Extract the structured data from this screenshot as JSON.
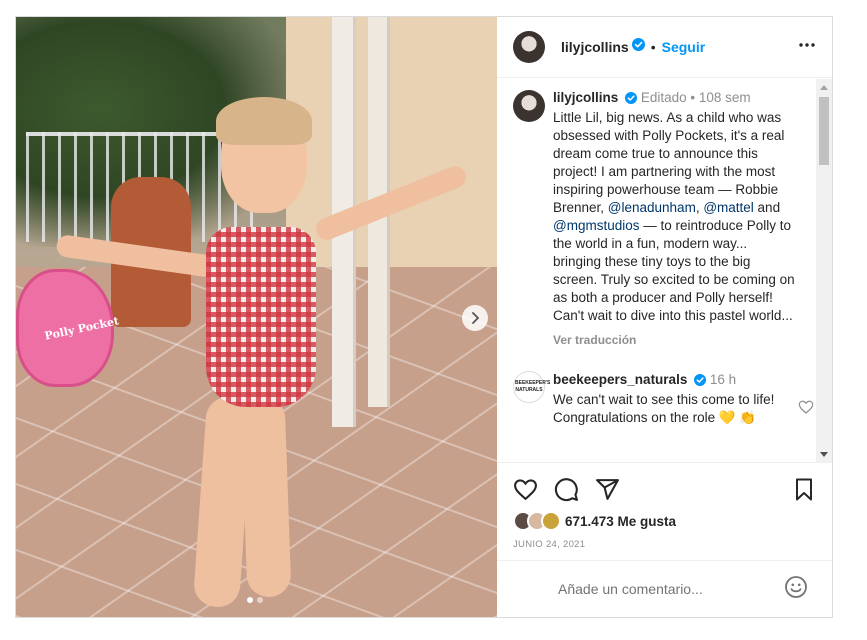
{
  "header": {
    "username": "lilyjcollins",
    "separator": "•",
    "follow_label": "Seguir",
    "more_label": "more"
  },
  "caption": {
    "username": "lilyjcollins",
    "meta": "Editado • 108 sem",
    "text_1": "Little Lil, big news. As a child who was obsessed with Polly Pockets, it's a real dream come true to announce this project! I am partnering with the most inspiring powerhouse team — Robbie Brenner, ",
    "mention_1": "@lenadunham",
    "text_2": ", ",
    "mention_2": "@mattel",
    "text_3": " and ",
    "mention_3": "@mgmstudios",
    "text_4": " — to reintroduce Polly to the world in a fun, modern way... bringing these tiny toys to the big screen. Truly so excited to be coming on as both a producer and Polly herself! Can't wait to dive into this pastel world...",
    "translate_label": "Ver traducción"
  },
  "comment": {
    "username": "beekeepers_naturals",
    "time": "16 h",
    "text": "We can't wait to see this come to life! Congratulations on the role 💛 👏",
    "avatar_text": "BEEKEEPER'S NATURALS"
  },
  "media": {
    "toy_label": "Polly Pocket",
    "dots": 2,
    "active_dot": 1
  },
  "actions": {
    "likes_text": "671.473 Me gusta",
    "date": "JUNIO 24, 2021"
  },
  "add_comment": {
    "placeholder": "Añade un comentario..."
  },
  "colors": {
    "accent": "#0095f6",
    "text": "#262626",
    "muted": "#8e8e8e",
    "mention": "#00376b",
    "verified": "#0095f6"
  }
}
